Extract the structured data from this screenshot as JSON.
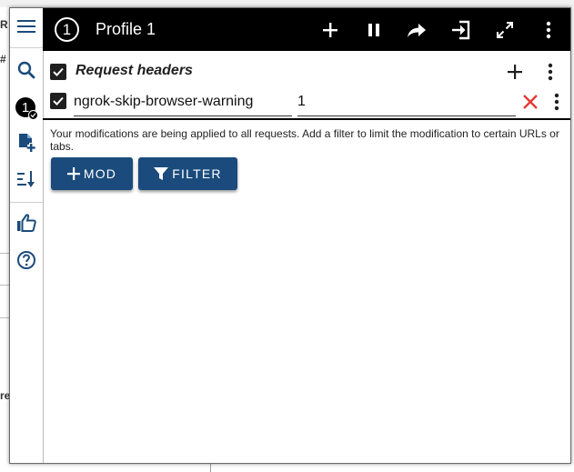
{
  "background_page": {
    "fragments": [
      "R",
      "#",
      "re"
    ]
  },
  "sidebar": {
    "items": [
      {
        "name": "menu-icon"
      },
      {
        "name": "search-icon"
      },
      {
        "name": "profile-badge",
        "label": "1"
      },
      {
        "name": "add-file-icon"
      },
      {
        "name": "sort-icon"
      },
      {
        "name": "thumbs-up-icon"
      },
      {
        "name": "help-icon"
      }
    ]
  },
  "header": {
    "profile_number": "1",
    "title": "Profile 1",
    "buttons": [
      "add-icon",
      "pause-icon",
      "share-icon",
      "import-icon",
      "fullscreen-icon",
      "more-icon"
    ]
  },
  "section": {
    "title": "Request headers",
    "checked": true
  },
  "header_entry": {
    "name": "ngrok-skip-browser-warning",
    "value": "1",
    "checked": true
  },
  "note": "Your modifications are being applied to all requests. Add a filter to limit the modification to certain URLs or tabs.",
  "actions": {
    "mod_label": "MOD",
    "filter_label": "FILTER"
  },
  "colors": {
    "header_bg": "#000000",
    "button_bg": "#1a4b7c",
    "delete_red": "#e53935"
  }
}
